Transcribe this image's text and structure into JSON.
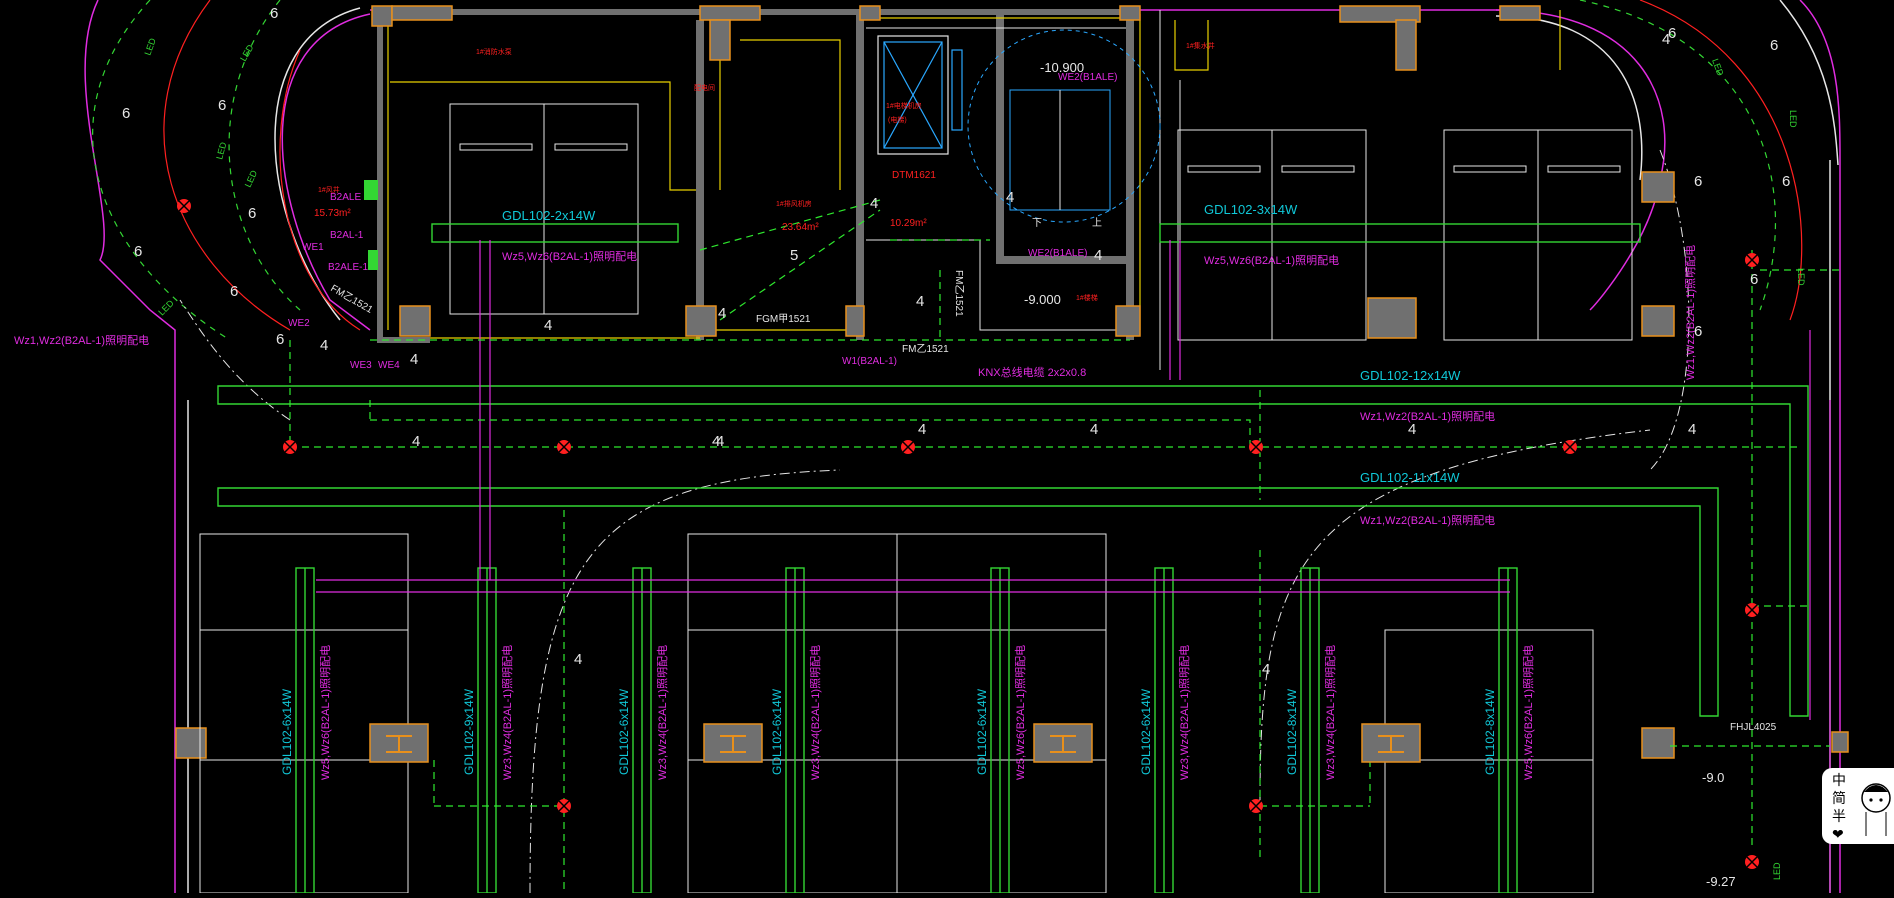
{
  "colors": {
    "bg": "#000000",
    "green": "#33d633",
    "dash_green": "#2ee82e",
    "magenta": "#e02ce0",
    "cyan": "#10c8d8",
    "yellow": "#e8d000",
    "wall": "#707070",
    "orange": "#e8901c",
    "red": "#ff2020",
    "white": "#e6e6e6",
    "blue": "#2aa8ff"
  },
  "trunk_labels": {
    "t1_gdl": "GDL102-2x14W",
    "t1_wz": "Wz5,Wz6(B2AL-1)照明配电",
    "t2_gdl": "GDL102-3x14W",
    "t2_wz": "Wz5,Wz6(B2AL-1)照明配电",
    "t3_gdl": "GDL102-12x14W",
    "t3_wz": "Wz1,Wz2(B2AL-1)照明配电",
    "t4_gdl": "GDL102-11x14W",
    "t4_wz": "Wz1,Wz2(B2AL-1)照明配电",
    "left_wz": "Wz1,Wz2(B2AL-1)照明配电",
    "right_wz": "Wz1,Wz2(B2AL-1)照明配电"
  },
  "vertical_runs": [
    {
      "gdl": "GDL102-6x14W",
      "wz": "Wz5,Wz6(B2AL-1)照明配电"
    },
    {
      "gdl": "GDL102-9x14W",
      "wz": "Wz3,Wz4(B2AL-1)照明配电"
    },
    {
      "gdl": "GDL102-6x14W",
      "wz": "Wz3,Wz4(B2AL-1)照明配电"
    },
    {
      "gdl": "GDL102-6x14W",
      "wz": "Wz3,Wz4(B2AL-1)照明配电"
    },
    {
      "gdl": "GDL102-6x14W",
      "wz": "Wz5,Wz6(B2AL-1)照明配电"
    },
    {
      "gdl": "GDL102-6x14W",
      "wz": "Wz3,Wz4(B2AL-1)照明配电"
    },
    {
      "gdl": "GDL102-8x14W",
      "wz": "Wz3,Wz4(B2AL-1)照明配电"
    },
    {
      "gdl": "GDL102-8x14W",
      "wz": "Wz5,Wz6(B2AL-1)照明配电"
    }
  ],
  "room_labels": {
    "area1": "23.64m²",
    "area2": "10.29m²",
    "area3": "15.73m²",
    "dt": "DTM1621",
    "fgm": "FGM甲1521",
    "fm1": "FM乙1521",
    "fm2": "FM乙1521",
    "fm3": "FM乙1521",
    "fhjl": "FHJL4025",
    "elev1": "-10.900",
    "elev2": "-9.000",
    "elev3": "-9.0",
    "elev4": "-9.27",
    "we2_a": "WE2(B1ALE)",
    "we2_b": "WE2(B1ALE)",
    "b2ale": "B2ALE",
    "b2al1": "B2AL-1",
    "b2ale1": "B2ALE-1",
    "we1": "WE1",
    "we2": "WE2",
    "we3": "WE3",
    "we4": "WE4",
    "w1": "W1(B2AL-1)",
    "knx": "KNX总线电缆 2x2x0.8",
    "room_a": "1#消防水泵",
    "room_b": "1#排风机房",
    "room_c": "配电间",
    "room_d": "1#集水井",
    "room_e": "1#电梯机房",
    "room_f": "1#楼梯",
    "room_g": "1#风井",
    "room_h": "(电梯)",
    "stair_down": "下",
    "stair_up": "上"
  },
  "small_nums": [
    "6",
    "6",
    "6",
    "6",
    "6",
    "6",
    "6",
    "6",
    "4",
    "4",
    "4",
    "4",
    "4",
    "4",
    "4",
    "4",
    "4",
    "4",
    "4",
    "4",
    "5",
    "4",
    "4",
    "4",
    "6",
    "6",
    "6",
    "6",
    "6",
    "4",
    "4",
    "4"
  ],
  "led": "LED",
  "ime": {
    "lines": [
      "中",
      "简",
      "半"
    ],
    "heart": "❤"
  }
}
